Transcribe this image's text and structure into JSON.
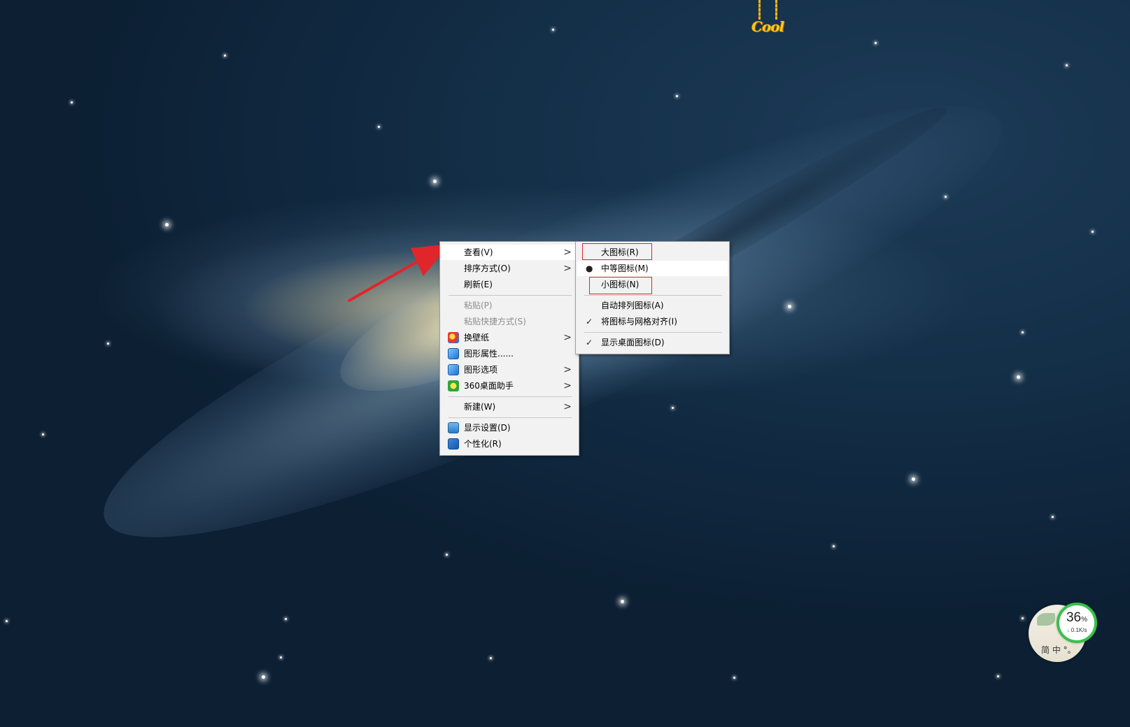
{
  "desktop": {
    "ornament_text": "Cool"
  },
  "context_menu": {
    "items": [
      {
        "label": "查看(V)",
        "has_submenu": true,
        "disabled": false,
        "icon": null
      },
      {
        "label": "排序方式(O)",
        "has_submenu": true,
        "disabled": false,
        "icon": null
      },
      {
        "label": "刷新(E)",
        "has_submenu": false,
        "disabled": false,
        "icon": null
      },
      {
        "label": "粘贴(P)",
        "has_submenu": false,
        "disabled": true,
        "icon": null
      },
      {
        "label": "粘贴快捷方式(S)",
        "has_submenu": false,
        "disabled": true,
        "icon": null
      },
      {
        "label": "换壁纸",
        "has_submenu": true,
        "disabled": false,
        "icon": "wallpaper-icon"
      },
      {
        "label": "图形属性......",
        "has_submenu": false,
        "disabled": false,
        "icon": "graphics-properties-icon"
      },
      {
        "label": "图形选项",
        "has_submenu": true,
        "disabled": false,
        "icon": "graphics-options-icon"
      },
      {
        "label": "360桌面助手",
        "has_submenu": true,
        "disabled": false,
        "icon": "360-assistant-icon"
      },
      {
        "label": "新建(W)",
        "has_submenu": true,
        "disabled": false,
        "icon": null
      },
      {
        "label": "显示设置(D)",
        "has_submenu": false,
        "disabled": false,
        "icon": "display-settings-icon"
      },
      {
        "label": "个性化(R)",
        "has_submenu": false,
        "disabled": false,
        "icon": "personalize-icon"
      }
    ],
    "submenu_arrow": ">"
  },
  "view_submenu": {
    "items": [
      {
        "label": "大图标(R)",
        "mark": ""
      },
      {
        "label": "中等图标(M)",
        "mark": "●"
      },
      {
        "label": "小图标(N)",
        "mark": ""
      },
      {
        "label": "自动排列图标(A)",
        "mark": ""
      },
      {
        "label": "将图标与网格对齐(I)",
        "mark": "✓"
      },
      {
        "label": "显示桌面图标(D)",
        "mark": "✓"
      }
    ]
  },
  "net_widget": {
    "percent": "36",
    "percent_unit": "%",
    "speed_arrow": "↓",
    "speed": "0.1K/s",
    "ime_text": "简 中 °。"
  },
  "colors": {
    "annotation_red": "#e0262b",
    "menu_bg": "#f2f2f2",
    "widget_ring": "#36c24a",
    "ornament_gold": "#f7c623"
  }
}
